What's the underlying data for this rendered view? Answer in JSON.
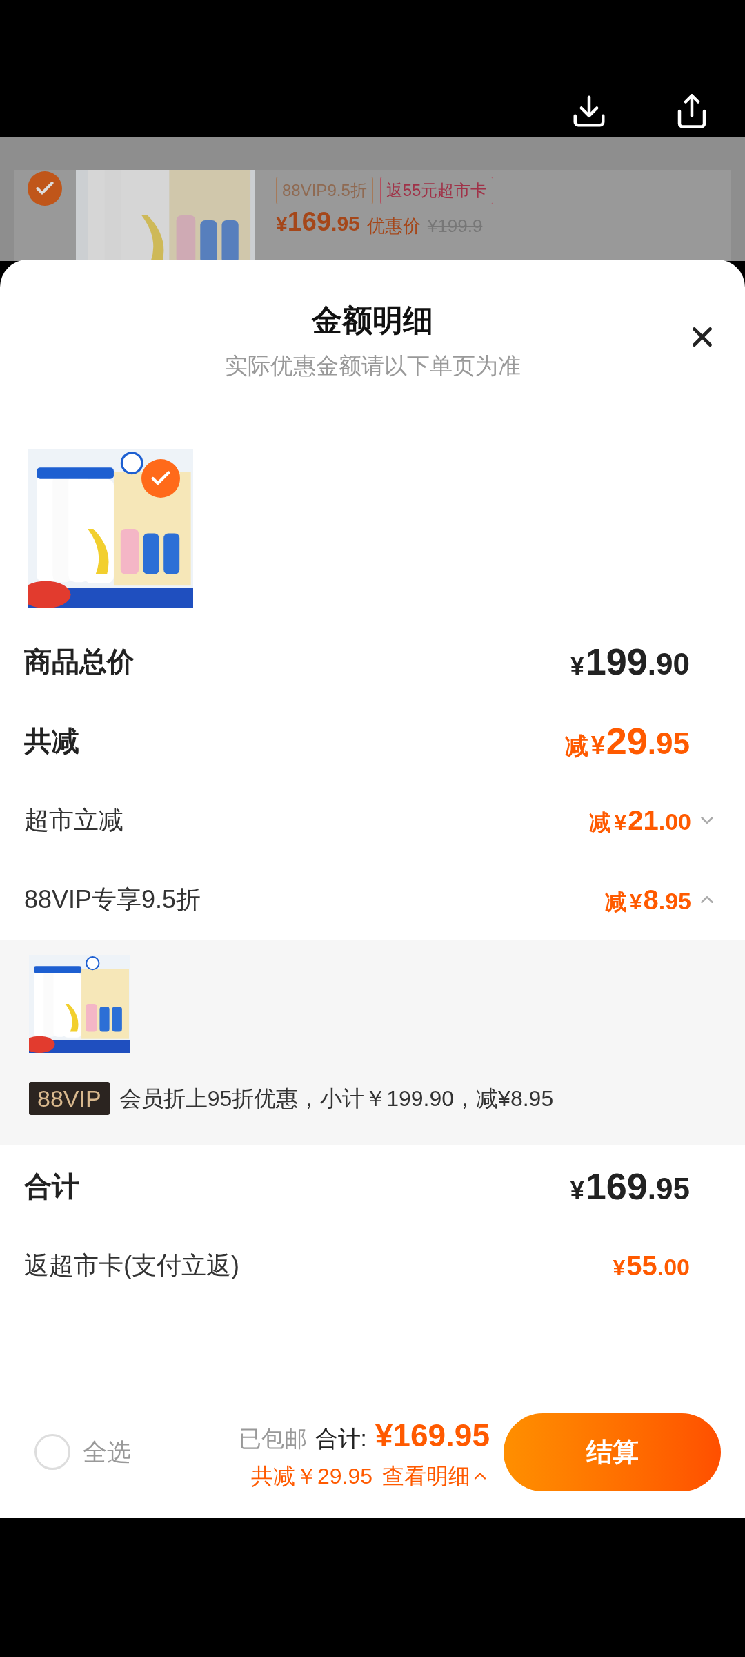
{
  "top_bar": {
    "buttons": [
      {
        "kind": "download"
      },
      {
        "kind": "share"
      }
    ]
  },
  "background_item": {
    "selected": true,
    "tags": [
      "88VIP9.5折",
      "返55元超市卡"
    ],
    "price": {
      "currency": "¥",
      "integer": "169",
      "decimal": ".95"
    },
    "price_label": "优惠价",
    "original_price": "¥199.9"
  },
  "sheet": {
    "title": "金额明细",
    "subtitle": "实际优惠金额请以下单页为准",
    "product": {
      "kind": "picture",
      "selected": true
    },
    "rows": [
      {
        "label": "商品总价",
        "kind": "total",
        "amount": {
          "currency": "¥",
          "integer": "199",
          "decimal": ".90"
        }
      },
      {
        "label": "共减",
        "kind": "discount_total",
        "amount": {
          "prefix": "减",
          "currency": "¥",
          "integer": "29",
          "decimal": ".95"
        }
      },
      {
        "label": "超市立减",
        "kind": "discount",
        "expanded": false,
        "amount": {
          "prefix": "减",
          "currency": "¥",
          "integer": "21",
          "decimal": ".00"
        }
      },
      {
        "label": "88VIP专享9.5折",
        "kind": "discount",
        "expanded": true,
        "amount": {
          "prefix": "减",
          "currency": "¥",
          "integer": "8",
          "decimal": ".95"
        }
      }
    ],
    "detail": {
      "badge": "88VIP",
      "text": "会员折上95折优惠，小计￥199.90，减¥8.95"
    },
    "summary": [
      {
        "label": "合计",
        "kind": "total",
        "amount": {
          "currency": "¥",
          "integer": "169",
          "decimal": ".95"
        }
      },
      {
        "label": "返超市卡(支付立返)",
        "kind": "rebate",
        "amount": {
          "currency": "¥",
          "integer": "55",
          "decimal": ".00"
        }
      }
    ]
  },
  "footer": {
    "select_all": {
      "label": "全选",
      "checked": false
    },
    "shipping": "已包邮",
    "total_label": "合计:",
    "total": "¥169.95",
    "savings": "共减￥29.95",
    "details_link": "查看明细",
    "checkout": "结算"
  }
}
